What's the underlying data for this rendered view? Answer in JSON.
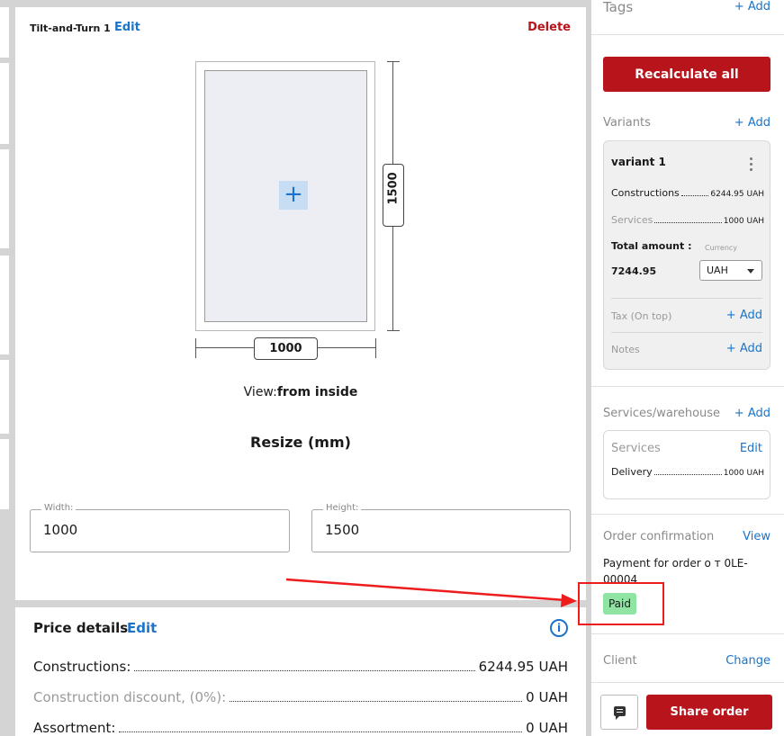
{
  "construction": {
    "title": "Tilt-and-Turn 1",
    "edit_label": "Edit",
    "delete_label": "Delete",
    "height_dim": "1500",
    "width_dim": "1000",
    "view_prefix": "View:",
    "view_value": "from inside",
    "resize_title": "Resize (mm)",
    "width_label": "Width:",
    "width_value": "1000",
    "height_label": "Height:",
    "height_value": "1500"
  },
  "price_details": {
    "title": "Price details",
    "edit_label": "Edit",
    "info_icon": "info-icon",
    "rows": [
      {
        "label": "Constructions:",
        "value": "6244.95 UAH"
      },
      {
        "label": "Construction discount, (0%):",
        "value": "0 UAH"
      },
      {
        "label": "Assortment:",
        "value": "0 UAH"
      }
    ]
  },
  "sidebar": {
    "tags_label": "Tags",
    "tags_add": "+ Add",
    "recalculate_label": "Recalculate all",
    "variants_label": "Variants",
    "variants_add": "+ Add",
    "variant": {
      "name": "variant 1",
      "constructions_label": "Constructions",
      "constructions_value": "6244.95 UAH",
      "services_label": "Services",
      "services_value": "1000 UAH",
      "total_label": "Total amount :",
      "total_value": "7244.95",
      "currency_label": "Currency",
      "currency_value": "UAH",
      "tax_label": "Tax (On top)",
      "tax_add": "+ Add",
      "notes_label": "Notes",
      "notes_add": "+ Add"
    },
    "services_warehouse_label": "Services/warehouse",
    "services_warehouse_add": "+ Add",
    "services_card": {
      "label": "Services",
      "edit_label": "Edit",
      "delivery_label": "Delivery",
      "delivery_value": "1000 UAH"
    },
    "order_confirmation_label": "Order confirmation",
    "order_confirmation_view": "View",
    "payment_text": "Payment for order о т 0LE-00004",
    "paid_badge": "Paid",
    "client_label": "Client",
    "client_change": "Change",
    "share_label": "Share order",
    "chat_icon": "chat-icon"
  },
  "colors": {
    "brand_red": "#b8141c",
    "link_blue": "#1b74c9",
    "paid_green": "#8fe3a3",
    "annotation_red": "#ee1c1c"
  }
}
